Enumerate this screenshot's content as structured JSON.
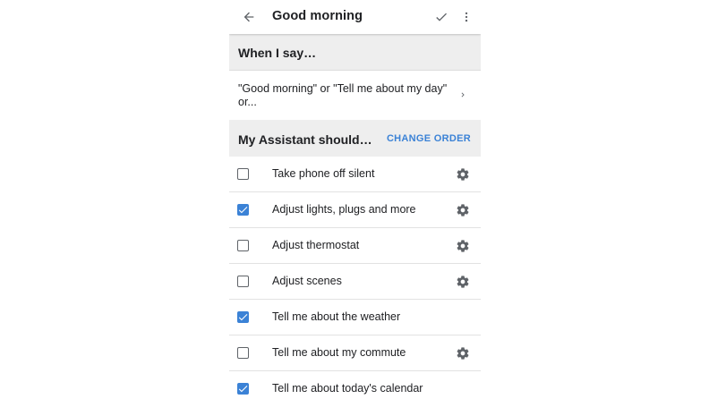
{
  "header": {
    "title": "Good morning",
    "back_icon": "arrow-back-icon",
    "check_icon": "check-icon",
    "more_icon": "more-vert-icon"
  },
  "when_section": {
    "label": "When I say…",
    "phrase": "\"Good morning\" or \"Tell me about my day\" or...",
    "chevron_icon": "chevron-right-icon"
  },
  "assistant_section": {
    "label": "My Assistant should…",
    "change_order": "CHANGE ORDER"
  },
  "actions": [
    {
      "label": "Take phone off silent",
      "checked": false,
      "has_settings": true
    },
    {
      "label": "Adjust lights, plugs and more",
      "checked": true,
      "has_settings": true
    },
    {
      "label": "Adjust thermostat",
      "checked": false,
      "has_settings": true
    },
    {
      "label": "Adjust scenes",
      "checked": false,
      "has_settings": true
    },
    {
      "label": "Tell me about the weather",
      "checked": true,
      "has_settings": false
    },
    {
      "label": "Tell me about my commute",
      "checked": false,
      "has_settings": true
    },
    {
      "label": "Tell me about today's calendar",
      "checked": true,
      "has_settings": false
    }
  ],
  "colors": {
    "accent": "#3b82d6",
    "section_bg": "#eeeeee",
    "icon": "#5f6368",
    "text": "#202124"
  }
}
